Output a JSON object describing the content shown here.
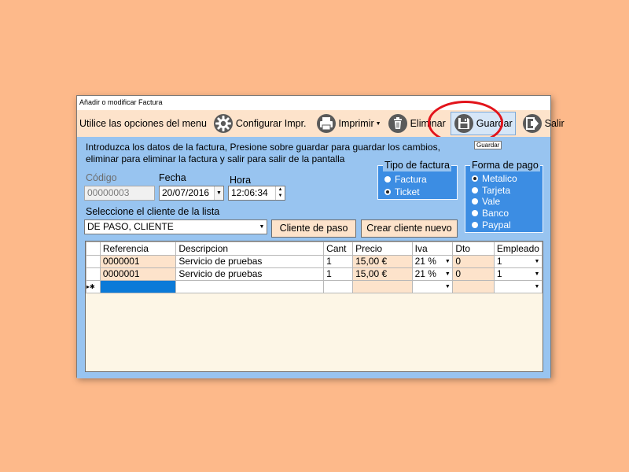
{
  "window": {
    "title": "Añadir o modificar Factura"
  },
  "toolbar": {
    "prompt": "Utilice las opciones del menu",
    "configurar": "Configurar Impr.",
    "imprimir": "Imprimir",
    "eliminar": "Eliminar",
    "guardar": "Guardar",
    "salir": "Salir",
    "tooltip": "Guardar"
  },
  "intro": {
    "text": "Introduzca los datos de la factura, Presione sobre guardar para guardar los cambios, eliminar para eliminar la factura y salir para salir de la pantalla"
  },
  "fields": {
    "codigo_label": "Código",
    "codigo_value": "00000003",
    "fecha_label": "Fecha",
    "fecha_value": "20/07/2016",
    "hora_label": "Hora",
    "hora_value": "12:06:34",
    "cliente_label": "Seleccione el cliente de la lista",
    "cliente_value": "DE PASO, CLIENTE"
  },
  "buttons": {
    "cliente_paso": "Cliente de paso",
    "crear_cliente": "Crear cliente nuevo"
  },
  "tipo_factura": {
    "title": "Tipo de factura",
    "options": [
      "Factura",
      "Ticket"
    ],
    "selected": "Ticket"
  },
  "forma_pago": {
    "title": "Forma de pago",
    "options": [
      "Metalico",
      "Tarjeta",
      "Vale",
      "Banco",
      "Paypal"
    ],
    "selected": "Metalico"
  },
  "grid": {
    "headers": [
      "Referencia",
      "Descripcion",
      "Cant",
      "Precio",
      "Iva",
      "Dto",
      "Empleado"
    ],
    "rows": [
      [
        "0000001",
        "Servicio de pruebas",
        "1",
        "15,00 €",
        "21 %",
        "0",
        "1"
      ],
      [
        "0000001",
        "Servicio de pruebas",
        "1",
        "15,00 €",
        "21 %",
        "0",
        "1"
      ]
    ],
    "new_row_marker": "▸✱"
  },
  "colors": {
    "background": "#fdb98a",
    "toolbar": "#fde3cb",
    "panel": "#98c4f0",
    "group": "#3c8de3",
    "highlight_ring": "#e2141b"
  }
}
